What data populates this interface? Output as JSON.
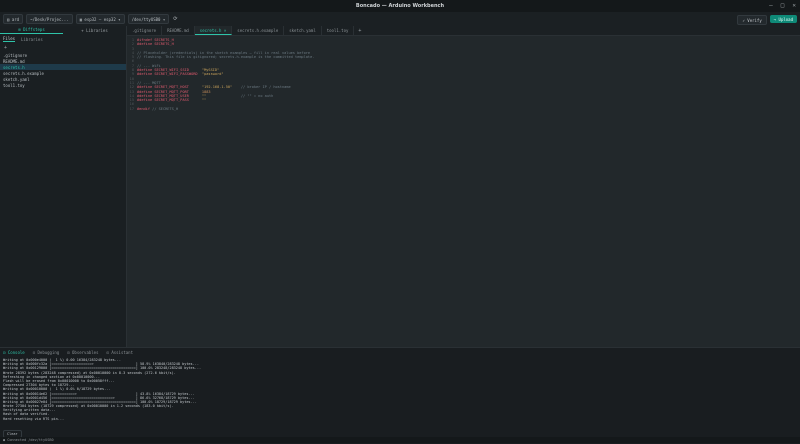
{
  "window": {
    "title": "Boncado — Arduino Workbench"
  },
  "toolbar": {
    "folder_label": "ard",
    "path_label": "~/Desk/Projec...",
    "board_label": "esp32 — esp32",
    "port_label": "/dev/ttyUSB0",
    "verify_label": "✓ Verify",
    "upload_label": "→ Upload"
  },
  "sidebar": {
    "header": {
      "left": "⊞ Diffsteps",
      "right": "+ Libraries"
    },
    "tabs": [
      "Files",
      "Libraries"
    ],
    "files": [
      ".gitignore",
      "README.md",
      "secrets.h",
      "secrets.h.example",
      "sketch.yaml",
      "tool1.toy"
    ],
    "active_index": 2
  },
  "editor": {
    "tabs": [
      ".gitignore",
      "README.md",
      "secrets.h",
      "secrets.h.example",
      "sketch.yaml",
      "tool1.toy"
    ],
    "active_tab": 2,
    "lines": [
      [
        {
          "t": "#ifndef ",
          "c": "kw"
        },
        {
          "t": "SECRETS_H",
          "c": "macro"
        }
      ],
      [
        {
          "t": "#define ",
          "c": "kw"
        },
        {
          "t": "SECRETS_H",
          "c": "macro"
        }
      ],
      [],
      [
        {
          "t": "// Placeholder (credentials) in the sketch examples — fill in real values before",
          "c": "comment"
        }
      ],
      [
        {
          "t": "// flashing. This file is gitignored; secrets.h.example is the committed template.",
          "c": "comment"
        }
      ],
      [],
      [
        {
          "t": "// --- WiFi",
          "c": "comment"
        }
      ],
      [
        {
          "t": "#define ",
          "c": "kw"
        },
        {
          "t": "SECRET_WIFI_SSID      ",
          "c": "macro"
        },
        {
          "t": "\"MySSID\"",
          "c": "str"
        }
      ],
      [
        {
          "t": "#define ",
          "c": "kw"
        },
        {
          "t": "SECRET_WIFI_PASSWORD  ",
          "c": "macro"
        },
        {
          "t": "\"password\"",
          "c": "str"
        }
      ],
      [],
      [
        {
          "t": "// --- MQTT",
          "c": "comment"
        }
      ],
      [
        {
          "t": "#define ",
          "c": "kw"
        },
        {
          "t": "SECRET_MQTT_HOST      ",
          "c": "macro"
        },
        {
          "t": "\"192.168.1.50\"",
          "c": "str"
        },
        {
          "t": "    // broker IP / hostname",
          "c": "comment"
        }
      ],
      [
        {
          "t": "#define ",
          "c": "kw"
        },
        {
          "t": "SECRET_MQTT_PORT      ",
          "c": "macro"
        },
        {
          "t": "1883",
          "c": "num"
        }
      ],
      [
        {
          "t": "#define ",
          "c": "kw"
        },
        {
          "t": "SECRET_MQTT_USER      ",
          "c": "macro"
        },
        {
          "t": "\"\"",
          "c": "str"
        },
        {
          "t": "                // \"\" = no auth",
          "c": "comment"
        }
      ],
      [
        {
          "t": "#define ",
          "c": "kw"
        },
        {
          "t": "SECRET_MQTT_PASS      ",
          "c": "macro"
        },
        {
          "t": "\"\"",
          "c": "str"
        }
      ],
      [],
      [
        {
          "t": "#endif ",
          "c": "kw"
        },
        {
          "t": "// SECRETS_H",
          "c": "comment"
        }
      ]
    ]
  },
  "bottom": {
    "tabs": [
      "⊡ Console",
      "⊡ Debugging",
      "⊡ Observables",
      "⊡ Assistant"
    ],
    "active_tab": 0,
    "console": [
      "Writing at 0x000e4000 (  1 %) 0.00 16384/283248 bytes...",
      "Writing at 0x000fc32a [===================>                    ] 58.9% 163840/283248 bytes...",
      "Writing at 0x00129000 [========================================] 100.0% 283248/283248 bytes...",
      "Wrote 28392 bytes (283248 compressed) at 0x00010000 in 8.3 seconds (272.6 kbit/s).",
      "Refreshing in changed section at 0x00010000...",
      "Flash will be erased from 0x00010000 to 0x00058fff...",
      "Compressed 27304 bytes to 18729...",
      "Writing at 0x00010000 (  1 %) 0.0% 0/18729 bytes...",
      "Writing at 0x00014e62 [===========>                            ] 43.8% 16384/18729 bytes...",
      "Writing at 0x0001d456 [=============================>          ] 86.6% 32768/18729 bytes...",
      "Writing at 0x00027e04 [========================================] 100.0% 18729/18729 bytes...",
      "Wrote 27304 bytes (18729 compressed) at 0x00010000 in 1.2 seconds (183.0 kbit/s).",
      "Verifying written data...",
      "Hash of data verified.",
      "Hard resetting via RTS pin..."
    ],
    "clear_label": "Clear"
  },
  "status": {
    "text": "● Connected /dev/ttyUSB0"
  },
  "icons": {
    "folder": "folder-icon",
    "board": "board-icon",
    "refresh": "refresh-icon",
    "minimize": "minimize-icon",
    "maximize": "maximize-icon",
    "close": "close-icon"
  }
}
